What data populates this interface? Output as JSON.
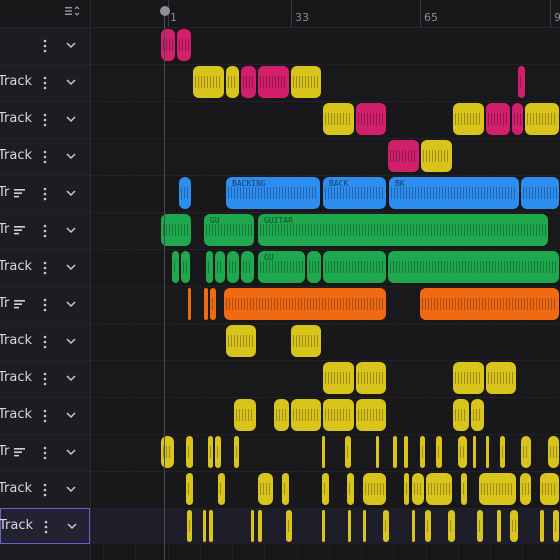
{
  "ruler": {
    "labels": [
      "1",
      "33",
      "65",
      "9"
    ]
  },
  "colors": {
    "pink": "#d21f6c",
    "yellow": "#d9c41c",
    "blue": "#2d8ef0",
    "green": "#1fa84e",
    "orange": "#ef6a12",
    "accent": "#6a5fd0"
  },
  "tracks": [
    {
      "name": "",
      "icon": ""
    },
    {
      "name": "Track",
      "icon": ""
    },
    {
      "name": "Track",
      "icon": ""
    },
    {
      "name": "Track",
      "icon": ""
    },
    {
      "name": "Tr",
      "icon": "notes-icon"
    },
    {
      "name": "Tr",
      "icon": "notes-icon"
    },
    {
      "name": "Track",
      "icon": ""
    },
    {
      "name": "Tr",
      "icon": "notes-icon"
    },
    {
      "name": "Track",
      "icon": ""
    },
    {
      "name": "Track",
      "icon": ""
    },
    {
      "name": "Track",
      "icon": ""
    },
    {
      "name": "Tr",
      "icon": "notes-icon"
    },
    {
      "name": "Track",
      "icon": ""
    },
    {
      "name": "Track",
      "icon": "",
      "selected": true
    }
  ],
  "clip_labels": {
    "backing": "BACKING",
    "back": "BACK",
    "bk": "BK",
    "gu": "GU",
    "guitar": "GUITAR",
    "gu2": "GU"
  }
}
